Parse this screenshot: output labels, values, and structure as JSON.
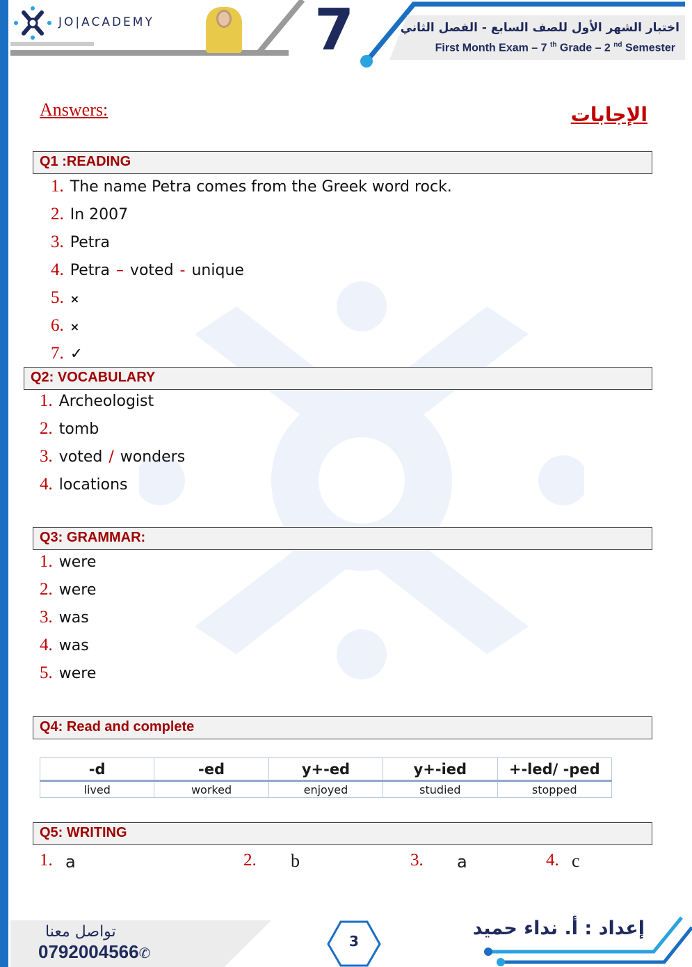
{
  "header": {
    "logo_text": "JO|ACADEMY",
    "grade_number": "7",
    "title_ar": "اختبار الشهر الأول للصف السابع - الفصل الثاني",
    "title_en_parts": [
      "First Month Exam – 7 ",
      "th",
      " Grade – 2 ",
      "nd",
      " Semester"
    ]
  },
  "answers_label": "Answers:",
  "answers_label_ar": "الإجابات",
  "q1": {
    "title": "Q1 :READING",
    "items": [
      {
        "n": "1.",
        "text": "The name Petra comes from the Greek word rock."
      },
      {
        "n": "2.",
        "text": "In 2007"
      },
      {
        "n": "3.",
        "text": "Petra"
      },
      {
        "n": "4.",
        "parts": [
          "Petra",
          "–",
          "voted",
          "-",
          "unique"
        ]
      },
      {
        "n": "5.",
        "text": "×"
      },
      {
        "n": "6.",
        "text": "×"
      },
      {
        "n": "7.",
        "text": "✓"
      }
    ]
  },
  "q2": {
    "title": "Q2: VOCABULARY",
    "items": [
      {
        "n": "1.",
        "text": "Archeologist"
      },
      {
        "n": "2.",
        "text": "tomb"
      },
      {
        "n": "3.",
        "parts": [
          "voted",
          "/",
          "wonders"
        ]
      },
      {
        "n": "4.",
        "text": "locations"
      }
    ]
  },
  "q3": {
    "title": "Q3: GRAMMAR:",
    "items": [
      {
        "n": "1.",
        "text": "were"
      },
      {
        "n": "2.",
        "text": "were"
      },
      {
        "n": "3.",
        "text": "was"
      },
      {
        "n": "4.",
        "text": "was"
      },
      {
        "n": "5.",
        "text": "were"
      }
    ]
  },
  "q4": {
    "title": "Q4: Read and complete",
    "headers": [
      "-d",
      "-ed",
      "y+-ed",
      "y+-ied",
      "+-led/  -ped"
    ],
    "row": [
      "lived",
      "worked",
      "enjoyed",
      "studied",
      "stopped"
    ]
  },
  "q5": {
    "title": "Q5: WRITING",
    "items": [
      {
        "n": "1.",
        "text": "a"
      },
      {
        "n": "2.",
        "text": "b"
      },
      {
        "n": "3.",
        "text": "a"
      },
      {
        "n": "4.",
        "text": "c"
      }
    ]
  },
  "footer": {
    "contact_ar": "تواصل معنا",
    "phone": "0792004566",
    "page": "3",
    "author_ar": "إعداد : أ. نداء حميد"
  },
  "colors": {
    "accent_blue": "#1b6fc2",
    "navy": "#1f2a5c",
    "answer_red": "#c00000"
  }
}
